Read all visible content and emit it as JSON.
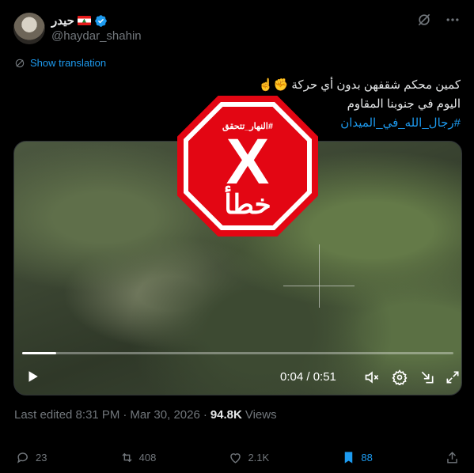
{
  "header": {
    "display_name": "حيدر",
    "handle": "@haydar_shahin"
  },
  "translation_link": "Show translation",
  "tweet": {
    "line1": "كمين محكم شقفهن بدون أي حركة",
    "line1_emoji": "✊☝",
    "line2": "اليوم في جنوبنا المقاوم",
    "hashtag": "#رجال_الله_في_الميدان"
  },
  "overlay": {
    "tag": "#النهار_تتحقق",
    "symbol": "X",
    "word": "خطأ"
  },
  "video": {
    "time": "0:04 / 0:51",
    "progress": 0.078
  },
  "meta": {
    "edited": "Last edited 8:31 PM",
    "separator": "·",
    "date": "Mar 30, 2026",
    "separator2": "·",
    "views_count": "94.8K",
    "views_label": "Views"
  },
  "actions": {
    "replies": "23",
    "reposts": "408",
    "likes": "2.1K",
    "bookmarks": "88"
  },
  "colors": {
    "accent": "#1d9bf0",
    "stamp_red": "#e30613"
  }
}
